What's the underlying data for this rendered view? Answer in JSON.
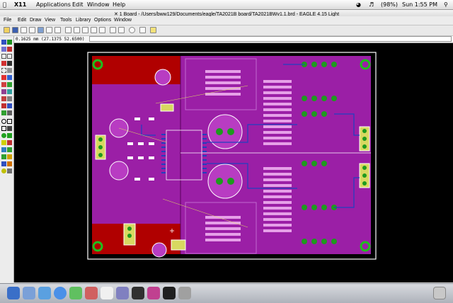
{
  "menubar": {
    "app": "X11",
    "items": [
      "Applications",
      "Edit",
      "Window",
      "Help"
    ],
    "battery": "(98%)",
    "clock": "Sun 1:55 PM"
  },
  "window": {
    "title": "1 Board - /Users/bww129/Documents/eagle/TA2021B board/TA2021BWv1.1.brd - EAGLE 4.15 Light"
  },
  "window_menu": [
    "File",
    "Edit",
    "Draw",
    "View",
    "Tools",
    "Library",
    "Options",
    "Window"
  ],
  "coordinate_readout": "0.1625 mm (27.1375 52.6500)",
  "colors": {
    "board_fill": "#9b1fa6",
    "copper_red": "#b00000",
    "background": "#000000",
    "outline": "#ffffff",
    "pad_green": "#1e9a1e"
  }
}
